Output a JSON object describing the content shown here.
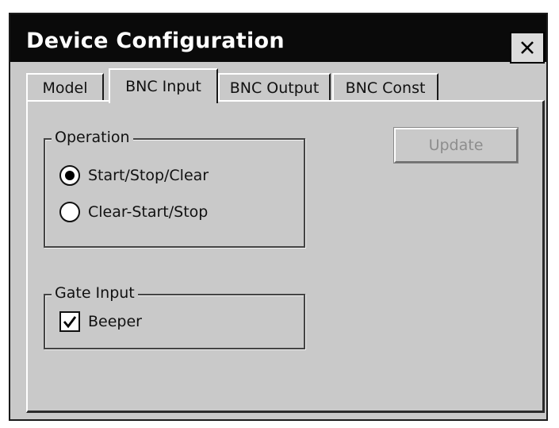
{
  "window": {
    "title": "Device Configuration",
    "close_label": "×"
  },
  "tabs": [
    {
      "label": "Model",
      "active": false
    },
    {
      "label": "BNC Input",
      "active": true
    },
    {
      "label": "BNC Output",
      "active": false
    },
    {
      "label": "BNC Const",
      "active": false
    }
  ],
  "operation": {
    "legend": "Operation",
    "options": [
      {
        "label": "Start/Stop/Clear",
        "checked": true
      },
      {
        "label": "Clear-Start/Stop",
        "checked": false
      }
    ]
  },
  "gate_input": {
    "legend": "Gate Input",
    "beeper_label": "Beeper",
    "beeper_checked": true
  },
  "update_button": {
    "label": "Update",
    "enabled": false
  },
  "colors": {
    "title_bar": "#0a0a0a",
    "panel_background": "#c9c9c9",
    "disabled_text": "#8d8d8d"
  },
  "icons": {
    "close": "close-icon",
    "check": "checkmark-icon"
  }
}
